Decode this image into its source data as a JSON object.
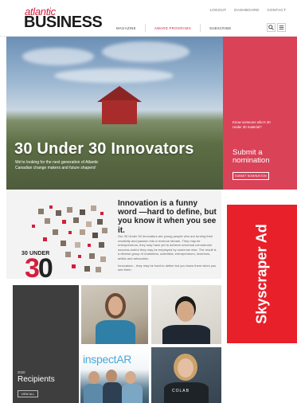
{
  "header": {
    "logo": {
      "line1": "atlantic",
      "line2": "BUSINESS"
    },
    "top_links": [
      "LOGOUT",
      "DASHBOARD",
      "CONTACT"
    ],
    "nav": [
      "MAGAZINE",
      "AWARD PROGRAMS",
      "SUBSCRIBE"
    ],
    "active_nav": "AWARD PROGRAMS",
    "icons": [
      "search-icon",
      "menu-icon"
    ]
  },
  "hero": {
    "title": "30 Under 30 Innovators",
    "subtitle": "We're looking for the next generation of Atlantic Canadian change makers and future shapers!",
    "panel": {
      "question": "Know someone who's 30 Under 30 material?",
      "title": "Submit a nomination",
      "button": "SUBMIT NOMINATION"
    }
  },
  "intro": {
    "logo_small": "30 UNDER",
    "logo_big_red": "3",
    "logo_big_dark": "0",
    "heading": "Innovation is a funny word —hard to define, but you know it when you see it.",
    "body1": "Our 30 Under 30 Innovators are young people who are turning their creativity and passion into a revenue stream. They may be entrepreneurs, they may have yet to achieve universal commercial success and/or they may be employed by someone else. The result is a diverse group of marketers, scientists, entrepreneurs, inventors, artists and advocates.",
    "body2": "Innovators... they may be hard to define but you know them when you see them."
  },
  "recipients": {
    "year": "2020",
    "title": "Recipients",
    "button": "VIEW ALL"
  },
  "photos": {
    "inspect_text": "inspectAR",
    "colab_text": "COLAB"
  },
  "ad": {
    "text": "Skyscraper Ad"
  },
  "colors": {
    "brand_red": "#d21f3c",
    "ad_red": "#e8202a",
    "dark_panel": "#3e3e3e"
  }
}
